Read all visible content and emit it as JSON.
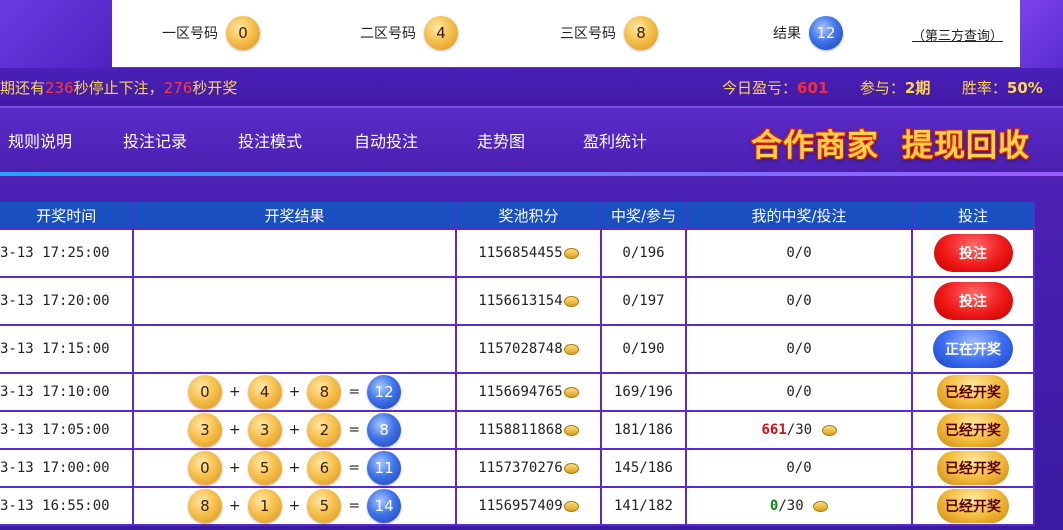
{
  "draw_bar": {
    "zones": [
      {
        "label": "一区号码",
        "value": "0",
        "color": "gold"
      },
      {
        "label": "二区号码",
        "value": "4",
        "color": "gold"
      },
      {
        "label": "三区号码",
        "value": "8",
        "color": "gold"
      },
      {
        "label": "结果",
        "value": "12",
        "color": "blue"
      }
    ],
    "third_party_link": "（第三方查询）"
  },
  "ticker": {
    "prefix": "期还有",
    "stop_seconds": "236",
    "mid": "秒停止下注，",
    "draw_seconds": "276",
    "suffix": "秒开奖"
  },
  "stats": {
    "today_label": "今日盈亏：",
    "today_value": "601",
    "join_label": "参与：",
    "join_value": "2期",
    "rate_label": "胜率：",
    "rate_value": "50%"
  },
  "nav": {
    "items": [
      "规则说明",
      "投注记录",
      "投注模式",
      "自动投注",
      "走势图",
      "盈利统计"
    ],
    "promo_partner": "合作商家",
    "promo_withdraw": "提现回收"
  },
  "table": {
    "headers": [
      "开奖时间",
      "开奖结果",
      "奖池积分",
      "中奖/参与",
      "我的中奖/投注",
      "投注"
    ],
    "rows": [
      {
        "time": "3-13 17:25:00",
        "pool": "1156854455",
        "ratio": "0/196",
        "mine_win": "",
        "mine_bet": "0/0",
        "action": "投注",
        "action_style": "red"
      },
      {
        "time": "3-13 17:20:00",
        "pool": "1156613154",
        "ratio": "0/197",
        "mine_win": "",
        "mine_bet": "0/0",
        "action": "投注",
        "action_style": "red"
      },
      {
        "time": "3-13 17:15:00",
        "pool": "1157028748",
        "ratio": "0/190",
        "mine_win": "",
        "mine_bet": "0/0",
        "action": "正在开奖",
        "action_style": "blue"
      },
      {
        "time": "3-13 17:10:00",
        "n1": "0",
        "n2": "4",
        "n3": "8",
        "sum": "12",
        "plus": "+",
        "eq": "=",
        "pool": "1156694765",
        "ratio": "169/196",
        "mine_win": "",
        "mine_bet": "0/0",
        "action": "已经开奖",
        "action_style": "gold"
      },
      {
        "time": "3-13 17:05:00",
        "n1": "3",
        "n2": "3",
        "n3": "2",
        "sum": "8",
        "plus": "+",
        "eq": "=",
        "pool": "1158811868",
        "ratio": "181/186",
        "mine_win": "661",
        "mine_bet": "/30",
        "mine_color": "red",
        "action": "已经开奖",
        "action_style": "gold"
      },
      {
        "time": "3-13 17:00:00",
        "n1": "0",
        "n2": "5",
        "n3": "6",
        "sum": "11",
        "plus": "+",
        "eq": "=",
        "pool": "1157370276",
        "ratio": "145/186",
        "mine_win": "",
        "mine_bet": "0/0",
        "action": "已经开奖",
        "action_style": "gold"
      },
      {
        "time": "3-13 16:55:00",
        "n1": "8",
        "n2": "1",
        "n3": "5",
        "sum": "14",
        "plus": "+",
        "eq": "=",
        "pool": "1156957409",
        "ratio": "141/182",
        "mine_win": "0",
        "mine_bet": "/30",
        "mine_color": "green",
        "action": "已经开奖",
        "action_style": "gold"
      }
    ]
  },
  "icons": {
    "coin": "coin-stack-icon"
  },
  "colors": {
    "accent_purple": "#5a2bd0",
    "header_blue": "#1a4fc2",
    "ticker_yellow": "#ffd84a",
    "alert_red": "#ff2a2a"
  }
}
